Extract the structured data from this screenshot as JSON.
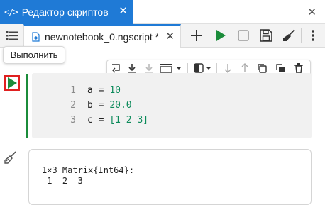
{
  "window": {
    "code_icon": "</>",
    "title": "Редактор скриптов",
    "close": "✕",
    "close_right": "✕"
  },
  "tabs": {
    "file_name": "newnotebook_0.ngscript *",
    "close": "✕"
  },
  "toolbar": {
    "items": [
      "menu-icon",
      "add-icon",
      "run-icon",
      "stop-icon",
      "save-icon",
      "clear-output-icon",
      "more-icon"
    ]
  },
  "tooltip": {
    "text": "Выполнить"
  },
  "cell": {
    "lines": [
      {
        "num": "1",
        "var": "a = ",
        "val": "10"
      },
      {
        "num": "2",
        "var": "b = ",
        "val": "20.0"
      },
      {
        "num": "3",
        "var": "c = ",
        "val": "[1 2 3]"
      }
    ]
  },
  "output": {
    "line1": "1×3 Matrix{Int64}:",
    "line2": " 1  2  3"
  },
  "colors": {
    "accent": "#1f7ad6",
    "run_green": "#1b8c3a",
    "highlight_red": "#e02020"
  }
}
